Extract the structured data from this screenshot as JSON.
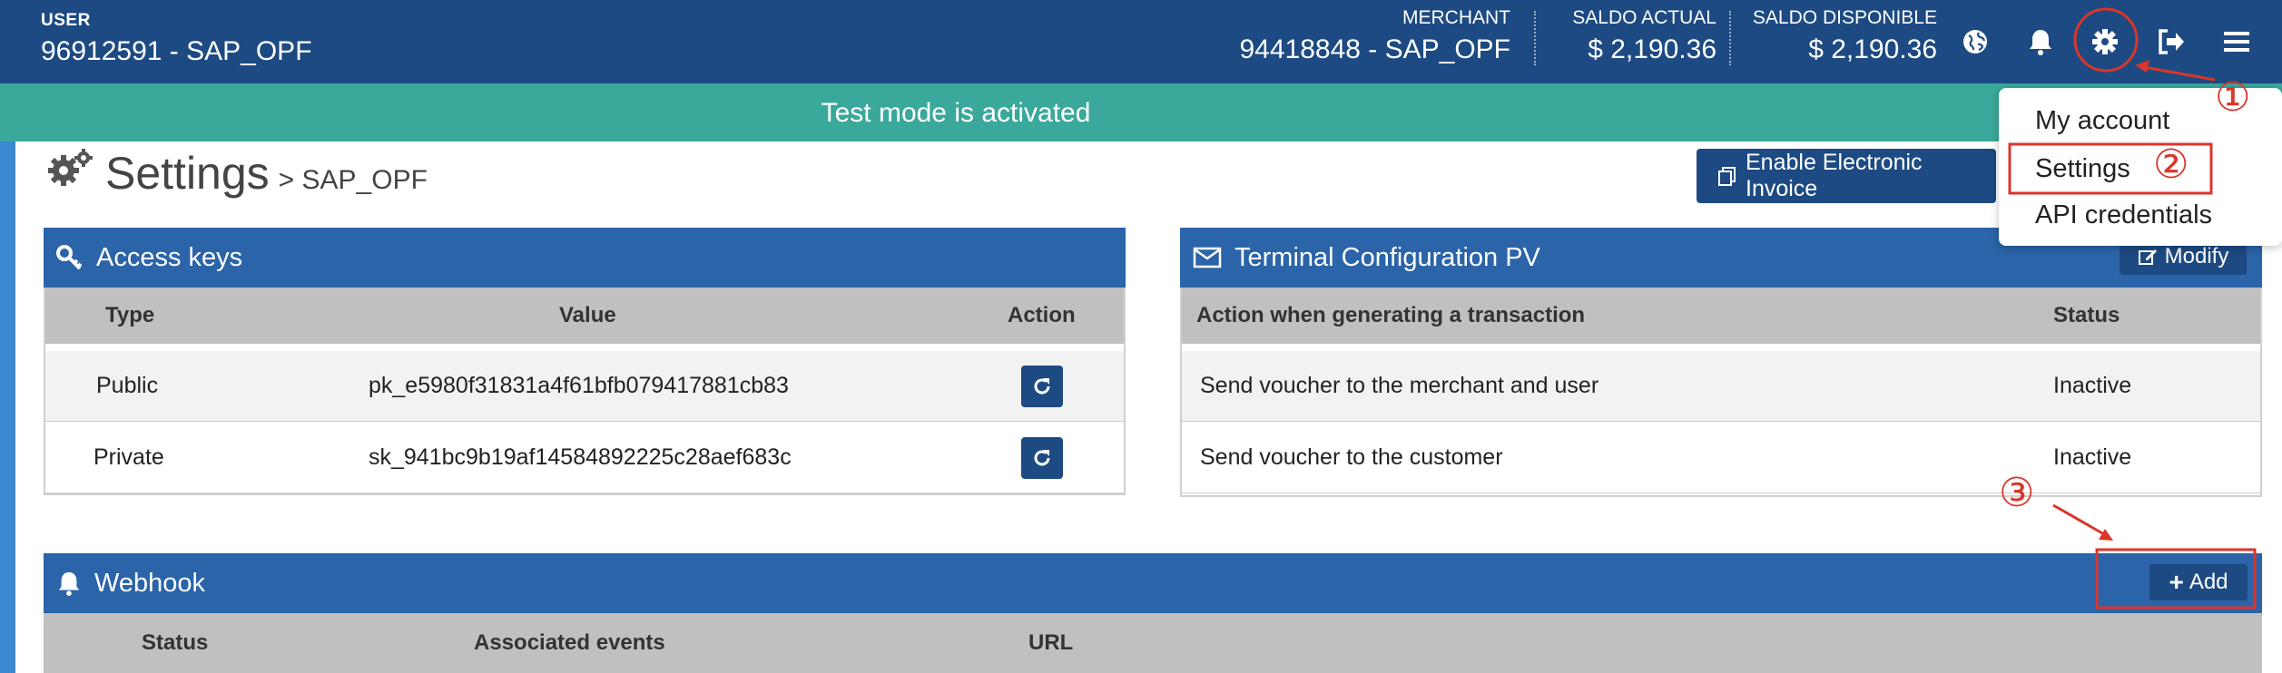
{
  "topbar": {
    "user_label": "USER",
    "user_name": "96912591 - SAP_OPF",
    "merchant_label": "MERCHANT",
    "merchant_value": "94418848 - SAP_OPF",
    "saldo_actual_label": "SALDO ACTUAL",
    "saldo_actual_value": "$ 2,190.36",
    "saldo_disponible_label": "SALDO DISPONIBLE",
    "saldo_disponible_value": "$ 2,190.36",
    "icons": [
      "globe-icon",
      "bell-icon",
      "gear-icon",
      "logout-icon",
      "menu-icon"
    ]
  },
  "banner": {
    "text": "Test mode is activated"
  },
  "page": {
    "title": "Settings",
    "subtitle": "> SAP_OPF",
    "einvoice_label": "Enable Electronic Invoice"
  },
  "access_keys": {
    "title": "Access keys",
    "columns": [
      "Type",
      "Value",
      "Action"
    ],
    "rows": [
      {
        "type": "Public",
        "value": "pk_e5980f31831a4f61bfb079417881cb83"
      },
      {
        "type": "Private",
        "value": "sk_941bc9b19af14584892225c28aef683c"
      }
    ]
  },
  "terminal": {
    "title": "Terminal Configuration PV",
    "modify_label": "Modify",
    "columns": [
      "Action when generating a transaction",
      "Status"
    ],
    "rows": [
      {
        "action": "Send voucher to the merchant and user",
        "status": "Inactive"
      },
      {
        "action": "Send voucher to the customer",
        "status": "Inactive"
      }
    ]
  },
  "webhook": {
    "title": "Webhook",
    "add_label": "Add",
    "columns": [
      "Status",
      "Associated events",
      "URL"
    ]
  },
  "dropdown": {
    "items": [
      "My account",
      "Settings",
      "API credentials"
    ]
  },
  "annotations": {
    "one": "①",
    "two": "②",
    "three": "③"
  },
  "colors": {
    "topbar": "#1d4a82",
    "banner": "#3aa99b",
    "panel_header": "#2b64a8",
    "annotation": "#d9362b"
  }
}
